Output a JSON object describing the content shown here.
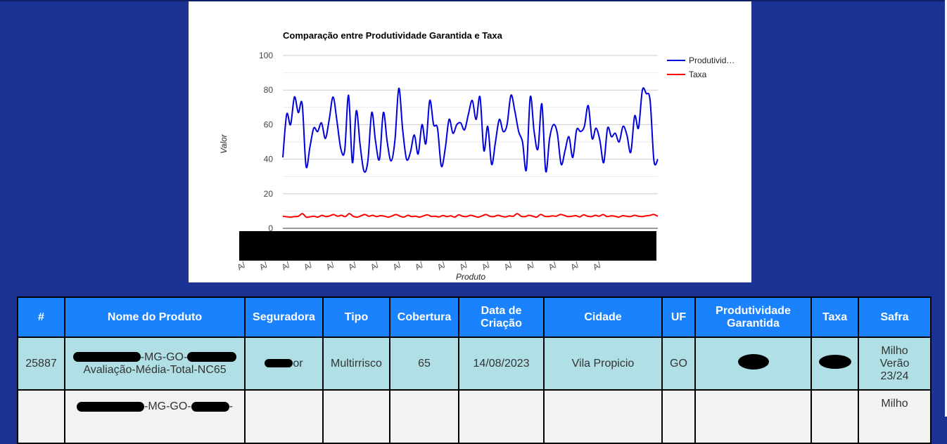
{
  "chart_data": {
    "type": "line",
    "title": "Comparação entre Produtividade Garantida e Taxa",
    "xlabel": "Produto",
    "ylabel": "Valor",
    "ylim": [
      0,
      100
    ],
    "yticks": [
      "0",
      "20",
      "40",
      "60",
      "80",
      "100"
    ],
    "xtick_prefix": "A/",
    "x_tick_count": 17,
    "grid": true,
    "legend_position": "right",
    "series": [
      {
        "name": "Produtividade Garantida",
        "legend_label": "Produtivid…",
        "color": "#0000dd",
        "values": [
          41,
          66,
          60,
          76,
          67,
          72,
          36,
          47,
          58,
          56,
          61,
          52,
          63,
          76,
          62,
          46,
          45,
          77,
          38,
          68,
          48,
          33,
          39,
          67,
          50,
          40,
          67,
          50,
          39,
          51,
          81,
          57,
          40,
          44,
          54,
          43,
          60,
          49,
          74,
          60,
          58,
          36,
          46,
          63,
          55,
          60,
          61,
          57,
          66,
          74,
          63,
          76,
          45,
          59,
          37,
          50,
          63,
          56,
          60,
          77,
          68,
          56,
          50,
          34,
          76,
          56,
          46,
          72,
          33,
          52,
          60,
          55,
          37,
          45,
          53,
          41,
          57,
          56,
          59,
          71,
          52,
          58,
          51,
          38,
          58,
          53,
          55,
          50,
          59,
          54,
          44,
          65,
          58,
          80,
          78,
          74,
          39,
          40
        ]
      },
      {
        "name": "Taxa",
        "color": "#ff0000",
        "values": [
          7,
          6.7,
          6.5,
          6.8,
          7,
          8.5,
          6.5,
          6.7,
          7,
          6.5,
          7.5,
          6.8,
          7.2,
          8,
          7,
          7.5,
          6.8,
          8.5,
          7,
          6.5,
          7.2,
          8,
          7,
          7.5,
          6.8,
          7.3,
          7,
          6.5,
          7.2,
          8,
          7,
          6.5,
          7.5,
          6.8,
          7,
          6.5,
          7.2,
          7.8,
          6.9,
          7,
          6.6,
          7.4,
          6.8,
          7.2,
          6.5,
          7.8,
          7,
          6.8,
          7.5,
          7,
          6.5,
          7.2,
          8,
          7,
          6.8,
          7.5,
          7,
          6.6,
          7.2,
          7,
          8.5,
          7,
          6.8,
          7.5,
          7,
          6.5,
          8,
          7,
          6.8,
          7.2,
          7,
          8,
          7.5,
          6.8,
          7,
          7.3,
          6.6,
          7.8,
          7,
          6.8,
          7.5,
          7,
          8,
          6.8,
          7.2,
          7,
          6.5,
          7.3,
          7,
          6.8,
          7.5,
          7,
          6.8,
          7.2,
          7.5,
          8,
          7
        ]
      }
    ]
  },
  "table": {
    "headers": [
      "#",
      "Nome do Produto",
      "Seguradora",
      "Tipo",
      "Cobertura",
      "Data de Criação",
      "Cidade",
      "UF",
      "Produtividade Garantida",
      "Taxa",
      "Safra"
    ],
    "rows": [
      {
        "id": "25887",
        "nome_mid": "-MG-GO-",
        "nome_tail": "Avaliação-Média-Total-NC65",
        "seguradora_tail": "or",
        "tipo": "Multirrisco",
        "cobertura": "65",
        "data": "14/08/2023",
        "cidade": "Vila Propicio",
        "uf": "GO",
        "safra_line1": "Milho",
        "safra_line2": "Verão",
        "safra_line3": "23/24"
      },
      {
        "nome_mid": "-MG-GO-",
        "nome_dash": "-",
        "safra_line1": "Milho"
      }
    ]
  }
}
